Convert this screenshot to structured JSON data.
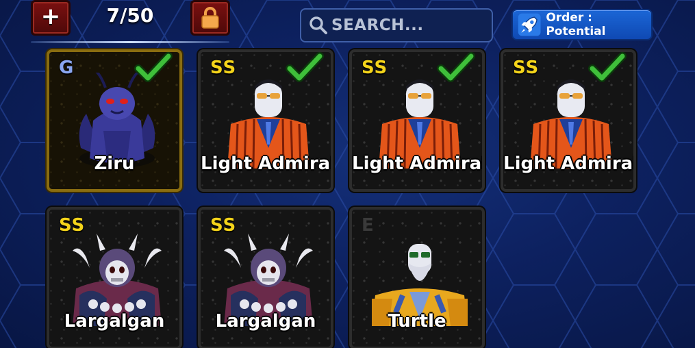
{
  "header": {
    "add_icon": "plus-icon",
    "lock_icon": "padlock-icon",
    "count": "7/50",
    "search_placeholder": "SEARCH...",
    "search_icon": "magnifier-icon",
    "order_icon": "rocket-icon",
    "order_label": "Order : Potential"
  },
  "colors": {
    "background": "#0d2160",
    "add_button": "#6a0e0e",
    "lock_button": "#6a0e0e",
    "order_button": "#1b66d6",
    "rank_ss": "#f4d41a",
    "rank_g": "#8aa6f0",
    "check": "#3fbf3a"
  },
  "units": [
    {
      "name": "Ziru",
      "rank": "G",
      "checked": true,
      "art": "dark-blue-insect-demon"
    },
    {
      "name": "Light Admiral",
      "rank": "SS",
      "checked": true,
      "art": "orange-suit-admiral"
    },
    {
      "name": "Light Admiral",
      "rank": "SS",
      "checked": true,
      "art": "orange-suit-admiral"
    },
    {
      "name": "Light Admiral",
      "rank": "SS",
      "checked": true,
      "art": "orange-suit-admiral"
    },
    {
      "name": "Largalgan",
      "rank": "SS",
      "checked": false,
      "art": "skull-armored-demon"
    },
    {
      "name": "Largalgan",
      "rank": "SS",
      "checked": false,
      "art": "skull-armored-demon"
    },
    {
      "name": "Turtle",
      "rank": "E",
      "checked": false,
      "art": "bald-old-master"
    }
  ]
}
